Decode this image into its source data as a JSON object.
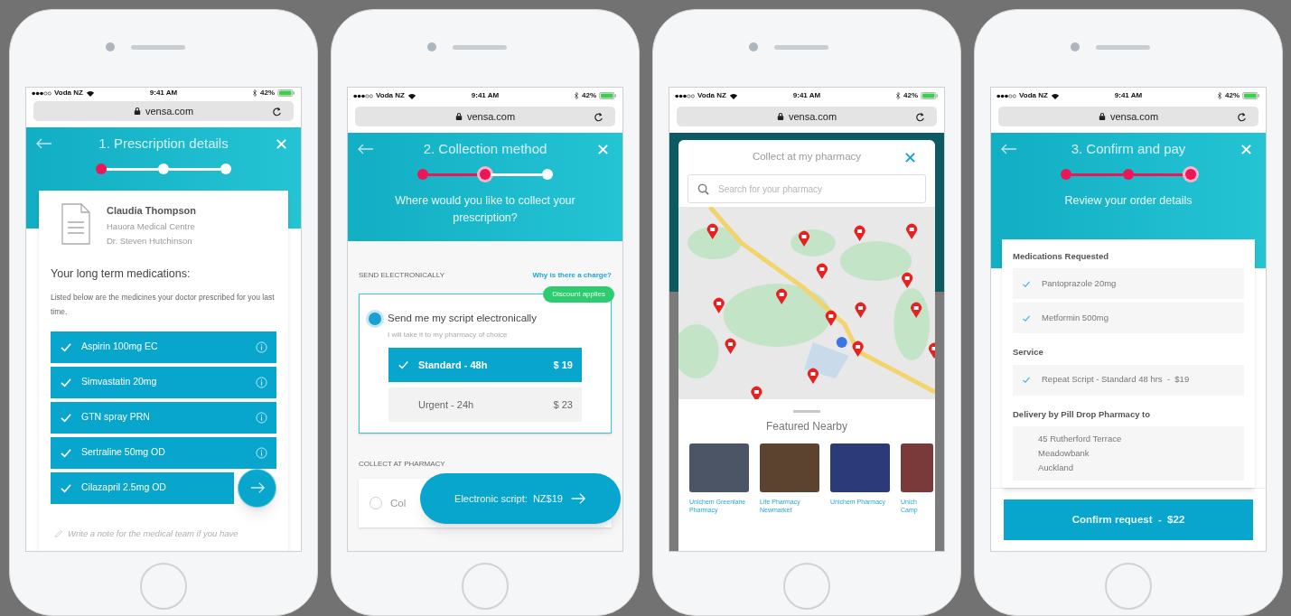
{
  "phones": [
    {
      "kind": "prescription",
      "status_bar": {
        "carrier": "Voda NZ",
        "time": "9:41 AM",
        "battery": "42%"
      },
      "url": "vensa.com",
      "header": {
        "title": "1. Prescription details",
        "steps": [
          {
            "done": true,
            "current": false
          },
          {
            "done": false,
            "current": false
          },
          {
            "done": false,
            "current": false
          }
        ]
      },
      "patient": {
        "name": "Claudia Thompson",
        "practice": "Hauora Medical Centre",
        "doctor": "Dr. Steven Hutchinson"
      },
      "heading": "Your long term medications:",
      "description": "Listed below are the medicines your doctor prescribed for you last time.",
      "medications": [
        {
          "name": "Aspirin 100mg EC",
          "checked": true,
          "info": true
        },
        {
          "name": "Simvastatin 20mg",
          "checked": true,
          "info": true
        },
        {
          "name": "GTN spray PRN",
          "checked": true,
          "info": true
        },
        {
          "name": "Sertraline 50mg OD",
          "checked": true,
          "info": true
        },
        {
          "name": "Cilazapril 2.5mg OD",
          "checked": true,
          "info": false
        }
      ],
      "note": {
        "placeholder": "Write a note for the medical team if you have"
      }
    },
    {
      "kind": "collection",
      "status_bar": {
        "carrier": "Voda NZ",
        "time": "9:41 AM",
        "battery": "42%"
      },
      "url": "vensa.com",
      "header": {
        "title": "2. Collection method",
        "subtitle": "Where would you like to collect your prescription?",
        "steps": [
          {
            "done": true,
            "current": false
          },
          {
            "done": true,
            "current": true
          },
          {
            "done": false,
            "current": false
          }
        ]
      },
      "sections": [
        {
          "label": "SEND ELECTRONICALLY",
          "link": "Why is there a charge?",
          "badge": "Discount applies",
          "option": {
            "label": "Send me my script electronically",
            "hint": "I will take it to my pharmacy of choice",
            "selected": true
          },
          "tiers": [
            {
              "label": "Standard - 48h",
              "price": "$ 19",
              "selected": true
            },
            {
              "label": "Urgent - 24h",
              "price": "$ 23",
              "selected": false
            }
          ]
        },
        {
          "label": "COLLECT AT PHARMACY",
          "option": {
            "label": "Col",
            "selected": false
          }
        }
      ],
      "fab": {
        "label": "Electronic script:  NZ$19"
      }
    },
    {
      "kind": "pharmacy_map",
      "status_bar": {
        "carrier": "Voda NZ",
        "time": "9:41 AM",
        "battery": "42%"
      },
      "url": "vensa.com",
      "modal": {
        "title": "Collect at my pharmacy",
        "search_placeholder": "Search for your pharmacy"
      },
      "featured": {
        "title": "Featured Nearby",
        "items": [
          {
            "name": "Unichem Greenlane Pharmacy"
          },
          {
            "name": "Life Pharmacy Newmarket"
          },
          {
            "name": "Unichem Pharmacy"
          },
          {
            "name": "Unich Camp"
          }
        ]
      }
    },
    {
      "kind": "confirm",
      "status_bar": {
        "carrier": "Voda NZ",
        "time": "9:41 AM",
        "battery": "42%"
      },
      "url": "vensa.com",
      "header": {
        "title": "3. Confirm and pay",
        "subtitle": "Review your order details",
        "steps": [
          {
            "done": true,
            "current": false
          },
          {
            "done": true,
            "current": false
          },
          {
            "done": true,
            "current": true
          }
        ]
      },
      "sections": [
        {
          "title": "Medications Requested",
          "items": [
            {
              "text": "Pantoprazole 20mg",
              "checked": true
            },
            {
              "text": "Metformin 500mg",
              "checked": true
            }
          ]
        },
        {
          "title": "Service",
          "items": [
            {
              "text": "Repeat Script - Standard 48 hrs  -  $19",
              "checked": true
            }
          ]
        },
        {
          "title": "Delivery by Pill Drop Pharmacy to",
          "address": [
            "45 Rutherford Terrace",
            "Meadowbank",
            "Auckland"
          ]
        }
      ],
      "button": "Confirm request  -  $22"
    }
  ]
}
